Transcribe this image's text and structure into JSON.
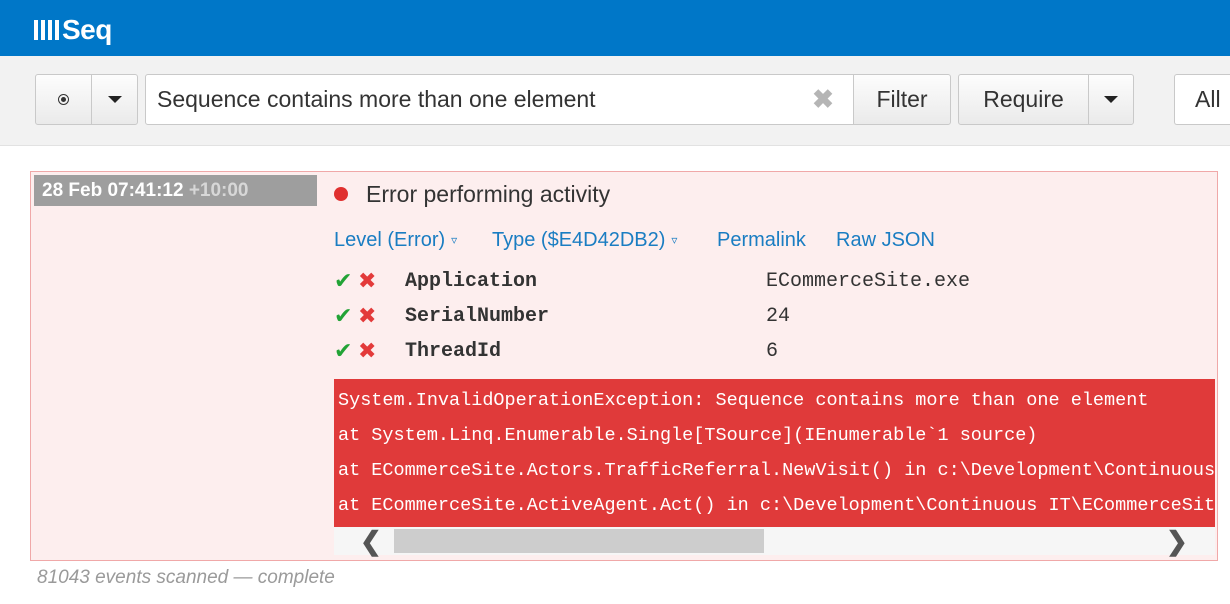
{
  "app": {
    "logo_text": "Seq"
  },
  "toolbar": {
    "search_value": "Sequence contains more than one element",
    "clear_glyph": "✖",
    "filter_label": "Filter",
    "require_label": "Require",
    "all_label": "All"
  },
  "event": {
    "timestamp": "28 Feb 07:41:12",
    "timezone": "+10:00",
    "title": "Error performing activity",
    "level_color": "#e0302f",
    "links": {
      "level": "Level (Error)",
      "type": "Type ($E4D42DB2)",
      "permalink": "Permalink",
      "raw_json": "Raw JSON",
      "dropdown_glyph": "▿"
    },
    "properties": [
      {
        "name": "Application",
        "value": "ECommerceSite.exe"
      },
      {
        "name": "SerialNumber",
        "value": "24"
      },
      {
        "name": "ThreadId",
        "value": "6"
      }
    ],
    "exception_lines": [
      "System.InvalidOperationException: Sequence contains more than one element",
      "   at System.Linq.Enumerable.Single[TSource](IEnumerable`1 source)",
      "   at ECommerceSite.Actors.TrafficReferral.NewVisit() in c:\\Development\\Continuous IT\\ECommerceSite\\Actors\\TrafficReferral.cs",
      "   at ECommerceSite.ActiveAgent.Act() in c:\\Development\\Continuous IT\\ECommerceSite\\ActiveAgent.cs"
    ],
    "check_glyph": "✔",
    "cross_glyph": "✖"
  },
  "scrollbar": {
    "left_glyph": "❮",
    "right_glyph": "❯"
  },
  "status": {
    "text": "81043 events scanned — complete"
  },
  "colors": {
    "brand": "#0077c8",
    "error": "#e03a3a",
    "link": "#1a7dc2"
  }
}
